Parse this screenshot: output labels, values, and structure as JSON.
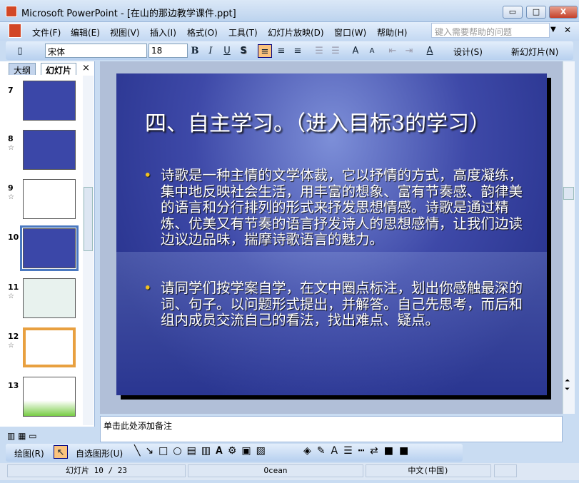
{
  "window": {
    "title": "Microsoft PowerPoint - [在山的那边教学课件.ppt]",
    "min": "▭",
    "max": "□",
    "close": "X"
  },
  "menu": [
    "文件(F)",
    "编辑(E)",
    "视图(V)",
    "插入(I)",
    "格式(O)",
    "工具(T)",
    "幻灯片放映(D)",
    "窗口(W)",
    "帮助(H)"
  ],
  "help_placeholder": "键入需要帮助的问题",
  "toolbar": {
    "font": "宋体",
    "size": "18",
    "bold": "B",
    "italic": "I",
    "underline": "U",
    "shadow": "S",
    "design": "设计(S)",
    "new_slide": "新幻灯片(N)"
  },
  "pane_tabs": {
    "outline": "大纲",
    "slides": "幻灯片",
    "close": "×"
  },
  "thumbnails": [
    {
      "num": "7",
      "star": ""
    },
    {
      "num": "8",
      "star": "☆"
    },
    {
      "num": "9",
      "star": "☆"
    },
    {
      "num": "10",
      "star": ""
    },
    {
      "num": "11",
      "star": "☆"
    },
    {
      "num": "12",
      "star": "☆"
    },
    {
      "num": "13",
      "star": ""
    }
  ],
  "slide": {
    "title": "四、自主学习。（进入目标3的学习）",
    "bullets": [
      "诗歌是一种主情的文学体裁，它以抒情的方式，高度凝练，集中地反映社会生活，用丰富的想象、富有节奏感、韵律美的语言和分行排列的形式来抒发思想情感。诗歌是通过精炼、优美又有节奏的语言抒发诗人的思想感情，让我们边读边议边品味，揣摩诗歌语言的魅力。",
      "请同学们按学案自学，在文中圈点标注，划出你感触最深的词、句子。以问题形式提出，并解答。自己先思考，而后和组内成员交流自己的看法，找出难点、疑点。"
    ]
  },
  "notes_placeholder": "单击此处添加备注",
  "drawbar": {
    "draw": "绘图(R)",
    "autoshapes": "自选图形(U)"
  },
  "status": {
    "slide": "幻灯片 10 / 23",
    "design": "Ocean",
    "lang": "中文(中国)"
  },
  "colors": {
    "accent": "#fbc37e",
    "slide_bg": "#3e49a8",
    "bullet": "#f0c020"
  }
}
